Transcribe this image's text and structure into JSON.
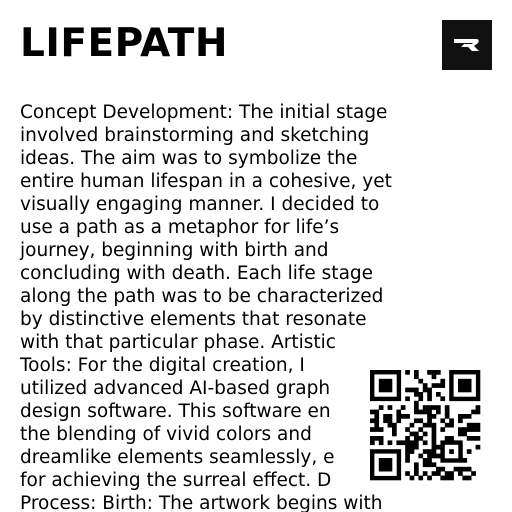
{
  "header": {
    "title": "LIFEPATH",
    "logo_icon": "brand-logo-icon"
  },
  "article": {
    "lines": [
      "Concept Development: The initial stage",
      "involved brainstorming and sketching",
      "ideas. The aim was to symbolize the",
      "entire human lifespan in a cohesive, yet",
      "visually engaging manner. I decided to",
      "use a path as a metaphor for life’s",
      "journey, beginning with birth and",
      "concluding with death. Each life stage",
      "along the path was to be characterized",
      "by distinctive elements that resonate",
      "with that particular phase. Artistic",
      "Tools: For the digital creation, I",
      "utilized advanced AI-based graph",
      "design software. This software en",
      "the blending of vivid colors and",
      "dreamlike elements seamlessly, e",
      "for achieving the surreal effect. D",
      "Process: Birth: The artwork begins with"
    ]
  },
  "qr_icon": "qr-code-icon",
  "colors": {
    "background": "#ffffff",
    "text": "#000000",
    "logo_bg": "#111111"
  }
}
